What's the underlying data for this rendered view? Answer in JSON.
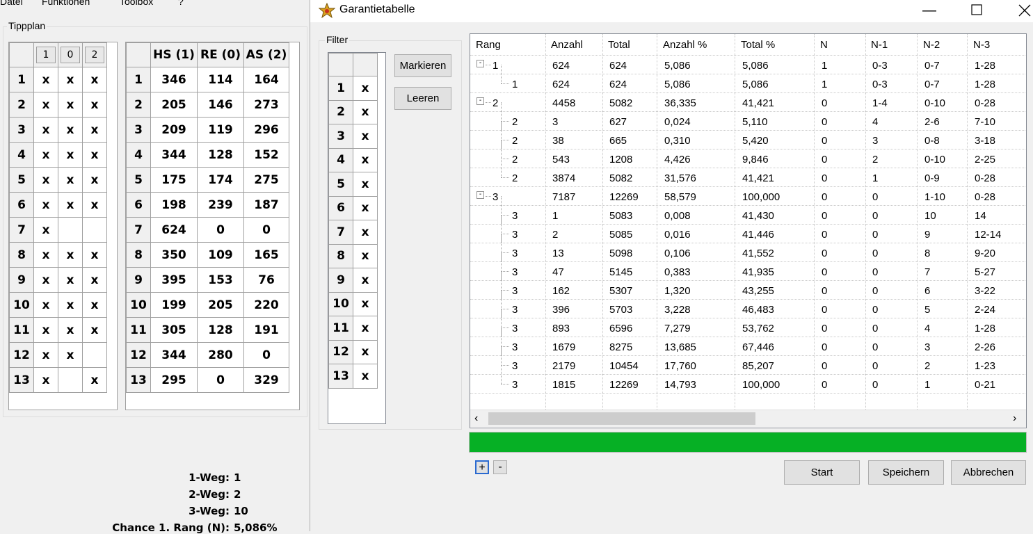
{
  "bg_app": {
    "menu": [
      "Datei",
      "Funktionen",
      "Toolbox",
      "?"
    ],
    "tippplan_title": "Tippplan",
    "tipp_headers": [
      "1",
      "0",
      "2"
    ],
    "tipp_rows": [
      {
        "n": "1",
        "c": [
          "x",
          "x",
          "x"
        ]
      },
      {
        "n": "2",
        "c": [
          "x",
          "x",
          "x"
        ]
      },
      {
        "n": "3",
        "c": [
          "x",
          "x",
          "x"
        ]
      },
      {
        "n": "4",
        "c": [
          "x",
          "x",
          "x"
        ]
      },
      {
        "n": "5",
        "c": [
          "x",
          "x",
          "x"
        ]
      },
      {
        "n": "6",
        "c": [
          "x",
          "x",
          "x"
        ]
      },
      {
        "n": "7",
        "c": [
          "x",
          "",
          ""
        ]
      },
      {
        "n": "8",
        "c": [
          "x",
          "x",
          "x"
        ]
      },
      {
        "n": "9",
        "c": [
          "x",
          "x",
          "x"
        ]
      },
      {
        "n": "10",
        "c": [
          "x",
          "x",
          "x"
        ]
      },
      {
        "n": "11",
        "c": [
          "x",
          "x",
          "x"
        ]
      },
      {
        "n": "12",
        "c": [
          "x",
          "x",
          ""
        ]
      },
      {
        "n": "13",
        "c": [
          "x",
          "",
          "x"
        ]
      }
    ],
    "stat_headers": [
      "HS (1)",
      "RE (0)",
      "AS (2)"
    ],
    "stat_rows": [
      {
        "n": "1",
        "c": [
          "346",
          "114",
          "164"
        ]
      },
      {
        "n": "2",
        "c": [
          "205",
          "146",
          "273"
        ]
      },
      {
        "n": "3",
        "c": [
          "209",
          "119",
          "296"
        ]
      },
      {
        "n": "4",
        "c": [
          "344",
          "128",
          "152"
        ]
      },
      {
        "n": "5",
        "c": [
          "175",
          "174",
          "275"
        ]
      },
      {
        "n": "6",
        "c": [
          "198",
          "239",
          "187"
        ]
      },
      {
        "n": "7",
        "c": [
          "624",
          "0",
          "0"
        ]
      },
      {
        "n": "8",
        "c": [
          "350",
          "109",
          "165"
        ]
      },
      {
        "n": "9",
        "c": [
          "395",
          "153",
          "76"
        ]
      },
      {
        "n": "10",
        "c": [
          "199",
          "205",
          "220"
        ]
      },
      {
        "n": "11",
        "c": [
          "305",
          "128",
          "191"
        ]
      },
      {
        "n": "12",
        "c": [
          "344",
          "280",
          "0"
        ]
      },
      {
        "n": "13",
        "c": [
          "295",
          "0",
          "329"
        ]
      }
    ],
    "stats": [
      {
        "label": "1-Weg:",
        "value": "1"
      },
      {
        "label": "2-Weg:",
        "value": "2"
      },
      {
        "label": "3-Weg:",
        "value": "10"
      },
      {
        "label": "Chance 1. Rang (N):",
        "value": "5,086%"
      }
    ]
  },
  "dialog": {
    "title": "Garantietabelle",
    "icon": "star-icon",
    "filter_title": "Filter",
    "filter_rows": [
      "1",
      "2",
      "3",
      "4",
      "5",
      "6",
      "7",
      "8",
      "9",
      "10",
      "11",
      "12",
      "13"
    ],
    "filter_mark": "x",
    "mark_button": "Markieren",
    "clear_button": "Leeren",
    "columns": [
      "Rang",
      "Anzahl",
      "Total",
      "Anzahl %",
      "Total %",
      "N",
      "N-1",
      "N-2",
      "N-3"
    ],
    "rows": [
      {
        "level": 0,
        "exp": "-",
        "c": [
          "1",
          "624",
          "624",
          "5,086",
          "5,086",
          "1",
          "0-3",
          "0-7",
          "1-28"
        ]
      },
      {
        "level": 1,
        "c": [
          "1",
          "624",
          "624",
          "5,086",
          "5,086",
          "1",
          "0-3",
          "0-7",
          "1-28"
        ]
      },
      {
        "level": 0,
        "exp": "-",
        "c": [
          "2",
          "4458",
          "5082",
          "36,335",
          "41,421",
          "0",
          "1-4",
          "0-10",
          "0-28"
        ]
      },
      {
        "level": 1,
        "c": [
          "2",
          "3",
          "627",
          "0,024",
          "5,110",
          "0",
          "4",
          "2-6",
          "7-10"
        ]
      },
      {
        "level": 1,
        "c": [
          "2",
          "38",
          "665",
          "0,310",
          "5,420",
          "0",
          "3",
          "0-8",
          "3-18"
        ]
      },
      {
        "level": 1,
        "c": [
          "2",
          "543",
          "1208",
          "4,426",
          "9,846",
          "0",
          "2",
          "0-10",
          "2-25"
        ]
      },
      {
        "level": 1,
        "c": [
          "2",
          "3874",
          "5082",
          "31,576",
          "41,421",
          "0",
          "1",
          "0-9",
          "0-28"
        ]
      },
      {
        "level": 0,
        "exp": "-",
        "c": [
          "3",
          "7187",
          "12269",
          "58,579",
          "100,000",
          "0",
          "0",
          "1-10",
          "0-28"
        ]
      },
      {
        "level": 1,
        "c": [
          "3",
          "1",
          "5083",
          "0,008",
          "41,430",
          "0",
          "0",
          "10",
          "14"
        ]
      },
      {
        "level": 1,
        "c": [
          "3",
          "2",
          "5085",
          "0,016",
          "41,446",
          "0",
          "0",
          "9",
          "12-14"
        ]
      },
      {
        "level": 1,
        "c": [
          "3",
          "13",
          "5098",
          "0,106",
          "41,552",
          "0",
          "0",
          "8",
          "9-20"
        ]
      },
      {
        "level": 1,
        "c": [
          "3",
          "47",
          "5145",
          "0,383",
          "41,935",
          "0",
          "0",
          "7",
          "5-27"
        ]
      },
      {
        "level": 1,
        "c": [
          "3",
          "162",
          "5307",
          "1,320",
          "43,255",
          "0",
          "0",
          "6",
          "3-22"
        ]
      },
      {
        "level": 1,
        "c": [
          "3",
          "396",
          "5703",
          "3,228",
          "46,483",
          "0",
          "0",
          "5",
          "2-24"
        ]
      },
      {
        "level": 1,
        "c": [
          "3",
          "893",
          "6596",
          "7,279",
          "53,762",
          "0",
          "0",
          "4",
          "1-28"
        ]
      },
      {
        "level": 1,
        "c": [
          "3",
          "1679",
          "8275",
          "13,685",
          "67,446",
          "0",
          "0",
          "3",
          "2-26"
        ]
      },
      {
        "level": 1,
        "c": [
          "3",
          "2179",
          "10454",
          "17,760",
          "85,207",
          "0",
          "0",
          "2",
          "1-23"
        ]
      },
      {
        "level": 1,
        "c": [
          "3",
          "1815",
          "12269",
          "14,793",
          "100,000",
          "0",
          "0",
          "1",
          "0-21"
        ]
      }
    ],
    "progress": 1.0,
    "progress_color": "#06b025",
    "expand_all": "+",
    "collapse_all": "-",
    "start_button": "Start",
    "save_button": "Speichern",
    "cancel_button": "Abbrechen"
  }
}
